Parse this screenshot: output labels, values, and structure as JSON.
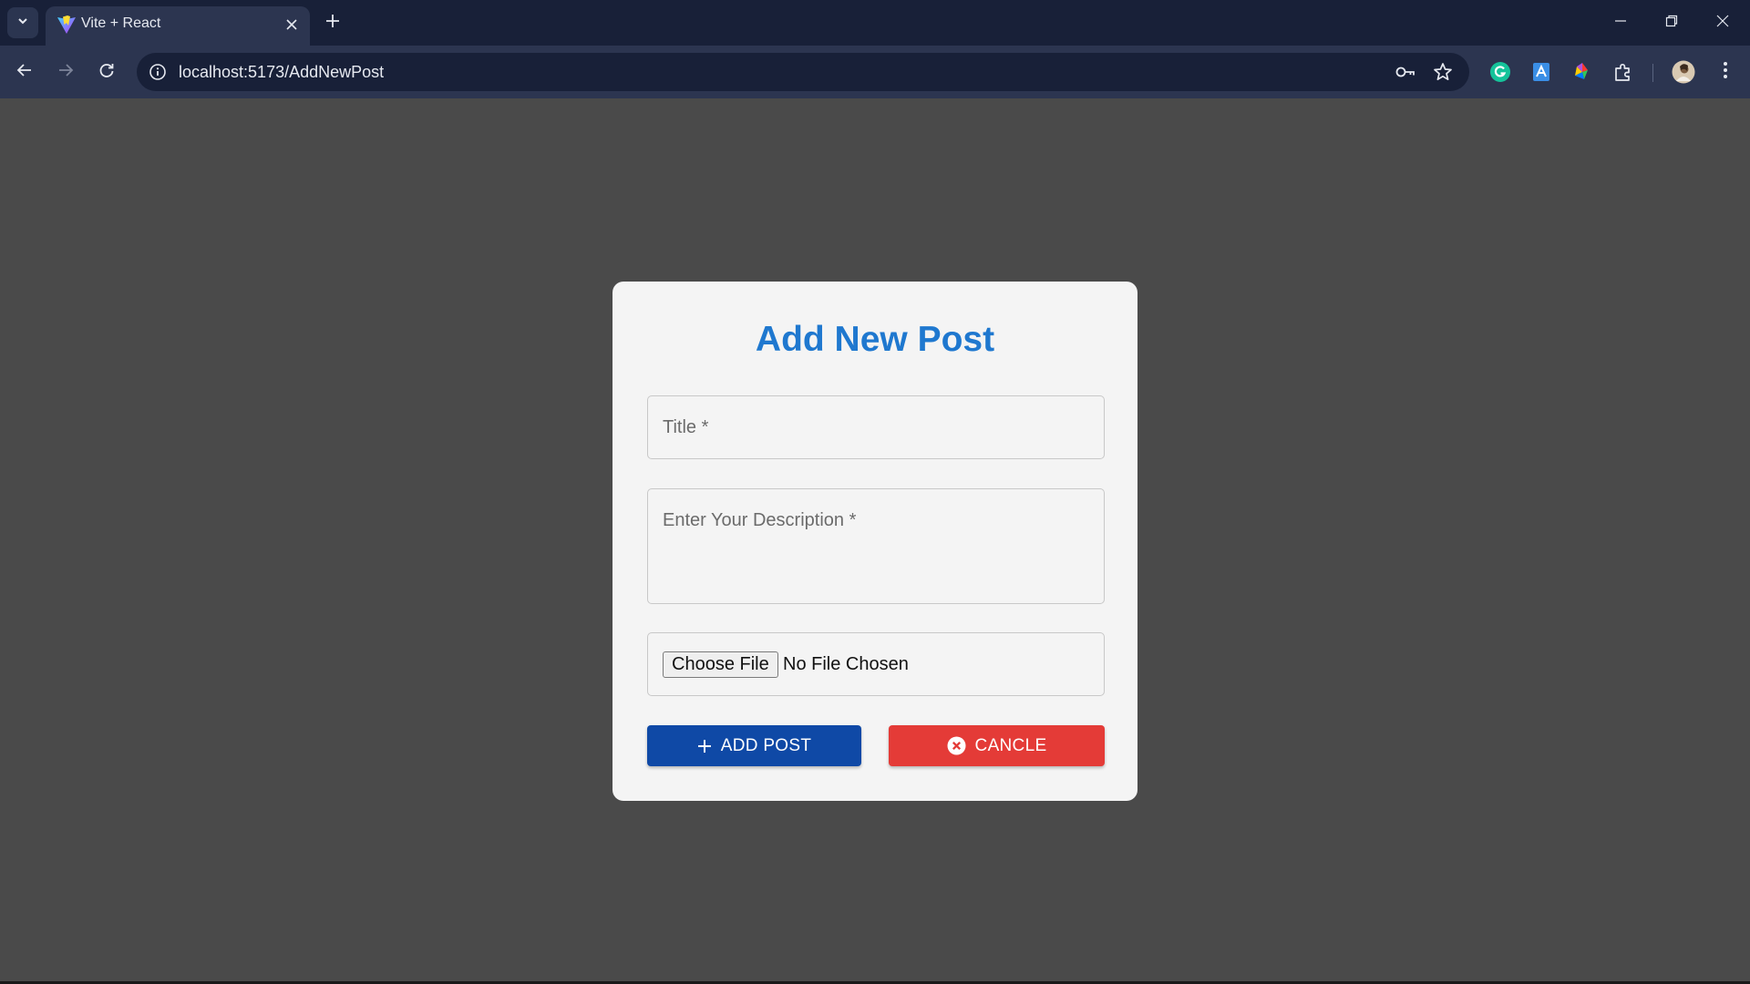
{
  "browser": {
    "tab": {
      "title": "Vite + React"
    },
    "url": "localhost:5173/AddNewPost"
  },
  "colors": {
    "title": "#1f78cf",
    "add_button": "#0f49a6",
    "cancel_button": "#e43b37",
    "page_background": "#4a4a4a",
    "card_background": "#f4f4f4"
  },
  "form": {
    "heading": "Add New Post",
    "title_field": {
      "label": "Title",
      "required_mark": "*"
    },
    "description_field": {
      "label": "Enter Your Description",
      "required_mark": "*"
    },
    "file_field": {
      "button_label": "Choose File",
      "status": "No File Chosen"
    },
    "add_button": {
      "label": "ADD POST",
      "icon": "plus-icon"
    },
    "cancel_button": {
      "label": "CANCLE",
      "icon": "cancel-circle-icon"
    }
  }
}
